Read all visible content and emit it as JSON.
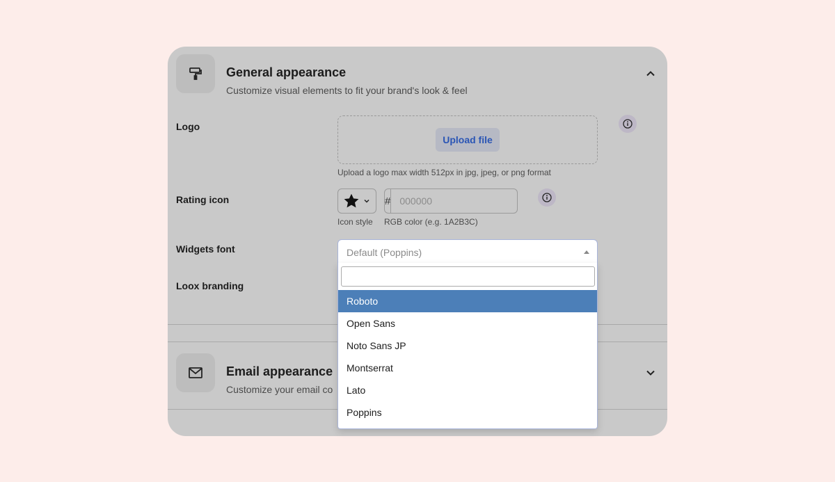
{
  "general": {
    "title": "General appearance",
    "subtitle": "Customize visual elements to fit your brand's look & feel"
  },
  "logo": {
    "label": "Logo",
    "upload_label": "Upload file",
    "help": "Upload a logo max width 512px in jpg, jpeg, or png format"
  },
  "rating": {
    "label": "Rating icon",
    "icon_style_help": "Icon style",
    "hash": "#",
    "color_placeholder": "000000",
    "color_help": "RGB color (e.g. 1A2B3C)",
    "swatch_color": "#000000"
  },
  "font": {
    "label": "Widgets font",
    "selected": "Default (Poppins)",
    "options": [
      "Roboto",
      "Open Sans",
      "Noto Sans JP",
      "Montserrat",
      "Lato",
      "Poppins"
    ],
    "highlighted": "Roboto"
  },
  "branding": {
    "label": "Loox branding"
  },
  "email": {
    "title": "Email appearance",
    "subtitle": "Customize your email co"
  }
}
